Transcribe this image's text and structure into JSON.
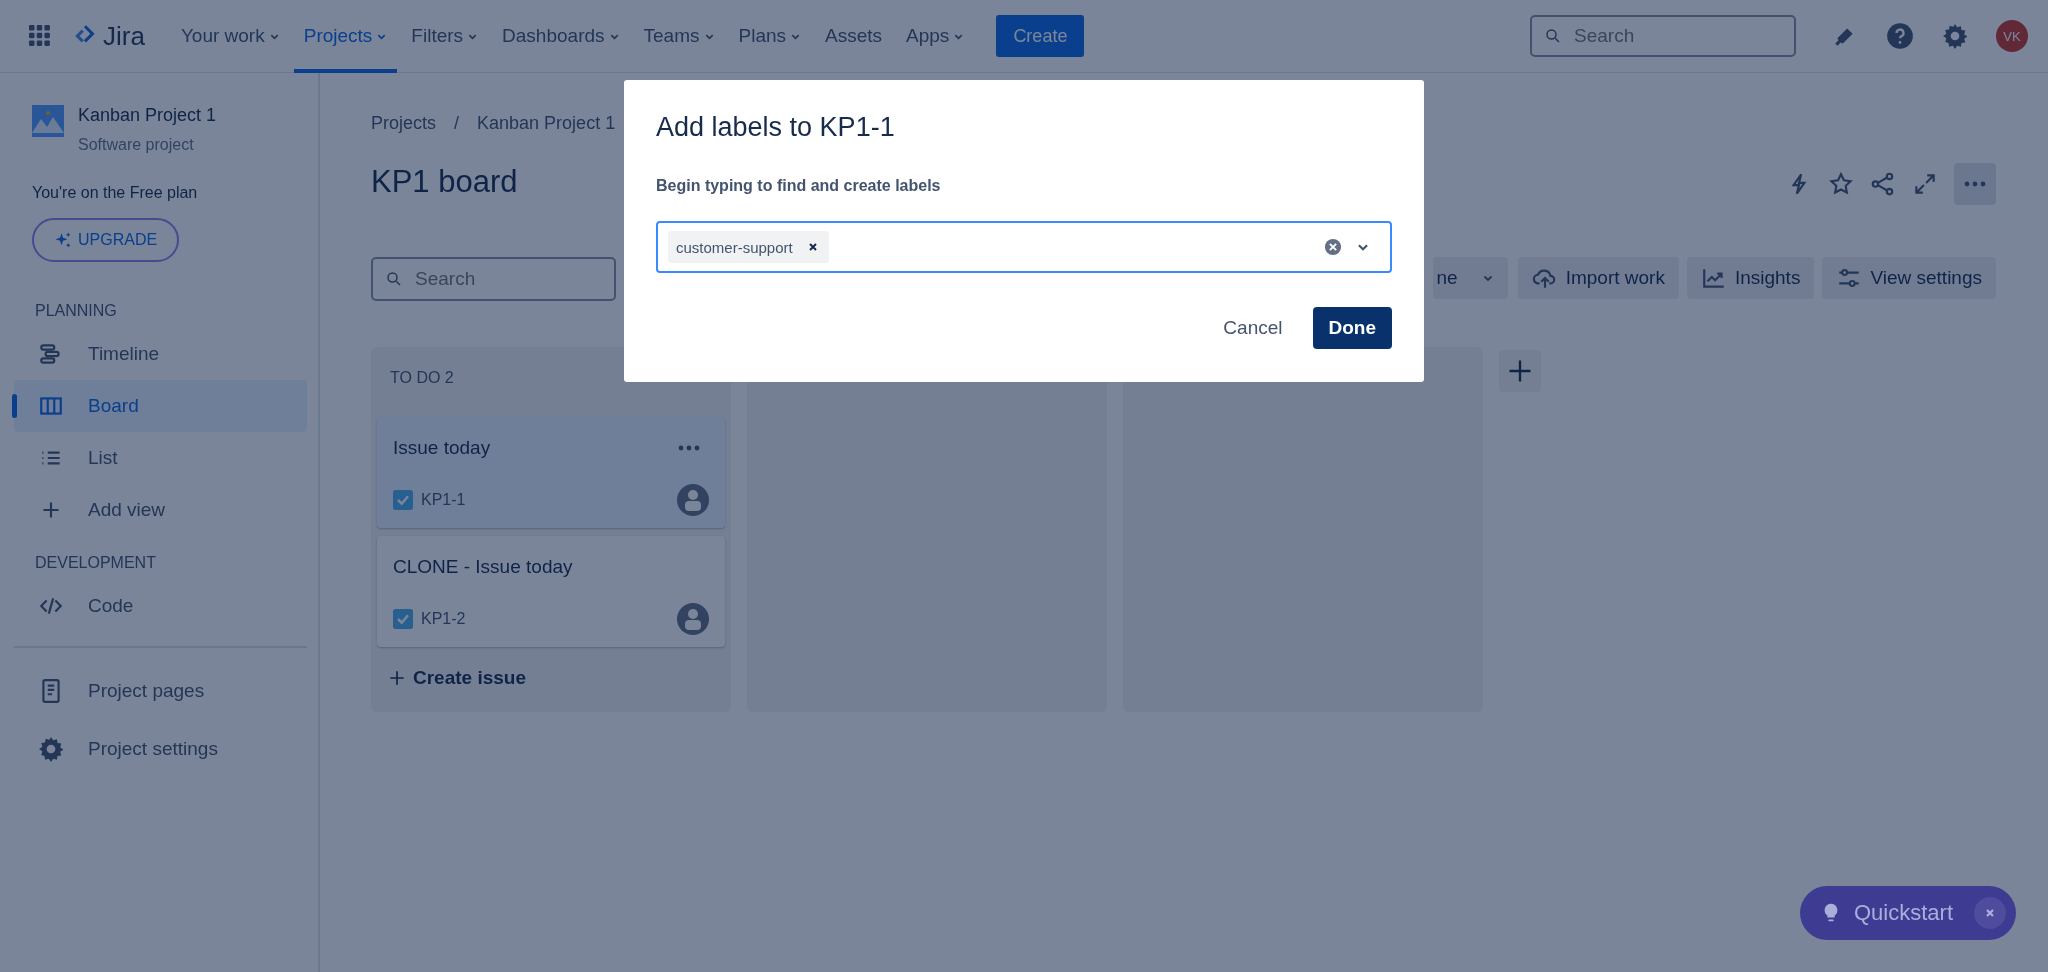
{
  "nav": {
    "logo": "Jira",
    "items": [
      {
        "label": "Your work",
        "dropdown": true,
        "selected": false
      },
      {
        "label": "Projects",
        "dropdown": true,
        "selected": true
      },
      {
        "label": "Filters",
        "dropdown": true,
        "selected": false
      },
      {
        "label": "Dashboards",
        "dropdown": true,
        "selected": false
      },
      {
        "label": "Teams",
        "dropdown": true,
        "selected": false
      },
      {
        "label": "Plans",
        "dropdown": true,
        "selected": false
      },
      {
        "label": "Assets",
        "dropdown": false,
        "selected": false
      },
      {
        "label": "Apps",
        "dropdown": true,
        "selected": false
      }
    ],
    "create": "Create",
    "search": {
      "placeholder": "Search"
    },
    "avatar": "VK"
  },
  "sidebar": {
    "project": {
      "name": "Kanban Project 1",
      "type": "Software project"
    },
    "plan_note": "You're on the Free plan",
    "upgrade": "UPGRADE",
    "sections": [
      {
        "heading": "PLANNING",
        "items": [
          {
            "label": "Timeline",
            "selected": false
          },
          {
            "label": "Board",
            "selected": true
          },
          {
            "label": "List",
            "selected": false
          },
          {
            "label": "Add view",
            "selected": false
          }
        ]
      },
      {
        "heading": "DEVELOPMENT",
        "items": [
          {
            "label": "Code",
            "selected": false
          }
        ]
      }
    ],
    "footer_items": [
      {
        "label": "Project pages"
      },
      {
        "label": "Project settings"
      }
    ]
  },
  "breadcrumbs": {
    "items": [
      "Projects",
      "Kanban Project 1"
    ],
    "separator": "/"
  },
  "title": "KP1 board",
  "toolbar": {
    "search": {
      "placeholder": "Search"
    },
    "buttons": [
      {
        "label": "ne",
        "kind": "dropdown"
      },
      {
        "label": "Import work",
        "kind": "import"
      },
      {
        "label": "Insights",
        "kind": "insights"
      },
      {
        "label": "View settings",
        "kind": "settings"
      }
    ]
  },
  "columns": [
    {
      "kind": "list",
      "title": "TO DO 2",
      "cards": [
        {
          "title": "Issue today",
          "key": "KP1-1",
          "selected": true
        },
        {
          "title": "CLONE - Issue today",
          "key": "KP1-2",
          "selected": false
        }
      ],
      "create": "Create issue"
    },
    {
      "kind": "empty"
    },
    {
      "kind": "empty"
    }
  ],
  "dialog": {
    "title": "Add labels to KP1-1",
    "field_label": "Begin typing to find and create labels",
    "labels": [
      "customer-support"
    ],
    "cancel": "Cancel",
    "done": "Done"
  },
  "quickstart": "Quickstart"
}
